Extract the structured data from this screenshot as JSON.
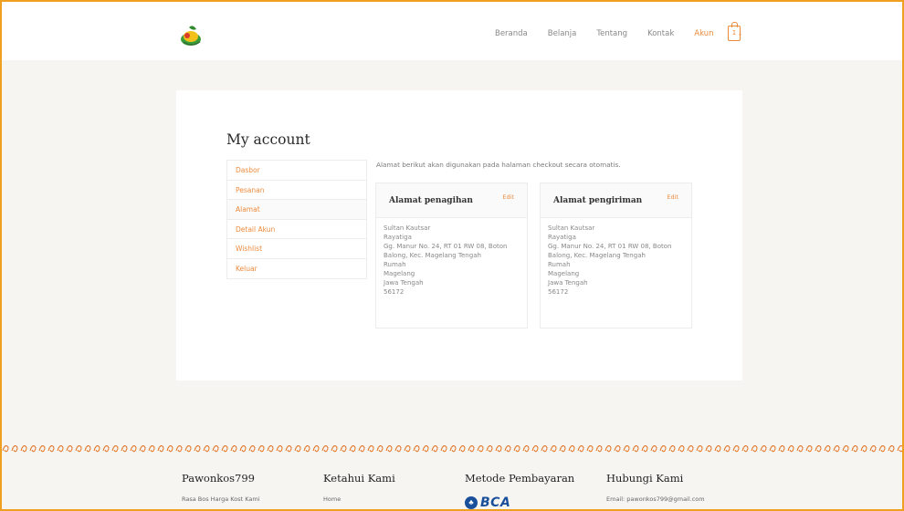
{
  "header": {
    "logo_icon": "pawonkos-logo-icon",
    "nav": [
      {
        "label": "Beranda"
      },
      {
        "label": "Belanja"
      },
      {
        "label": "Tentang"
      },
      {
        "label": "Kontak"
      },
      {
        "label": "Akun"
      }
    ],
    "cart_count": "1",
    "accent": "#ec8a3c"
  },
  "account": {
    "title": "My account",
    "menu": [
      {
        "label": "Dasbor"
      },
      {
        "label": "Pesanan"
      },
      {
        "label": "Alamat"
      },
      {
        "label": "Detail Akun"
      },
      {
        "label": "Wishlist"
      },
      {
        "label": "Keluar"
      }
    ],
    "intro": "Alamat berikut akan digunakan pada halaman checkout secara otomatis.",
    "billing": {
      "title": "Alamat penagihan",
      "edit": "Edit",
      "lines": [
        "Sultan Kautsar",
        "Rayatiga",
        "Gg. Manur No. 24, RT 01 RW 08, Boton",
        "Balong, Kec. Magelang Tengah",
        "Rumah",
        "Magelang",
        "Jawa Tengah",
        "56172"
      ]
    },
    "shipping": {
      "title": "Alamat pengiriman",
      "edit": "Edit",
      "lines": [
        "Sultan Kautsar",
        "Rayatiga",
        "Gg. Manur No. 24, RT 01 RW 08, Boton",
        "Balong, Kec. Magelang Tengah",
        "Rumah",
        "Magelang",
        "Jawa Tengah",
        "56172"
      ]
    }
  },
  "footer": {
    "col1": {
      "title": "Pawonkos799",
      "text": "Rasa Bos Harga Kost Kami"
    },
    "col2": {
      "title": "Ketahui Kami",
      "text": "Home"
    },
    "col3": {
      "title": "Metode Pembayaran",
      "bank": "BCA"
    },
    "col4": {
      "title": "Hubungi Kami",
      "text": "Email: pawonkos799@gmail.com"
    }
  }
}
